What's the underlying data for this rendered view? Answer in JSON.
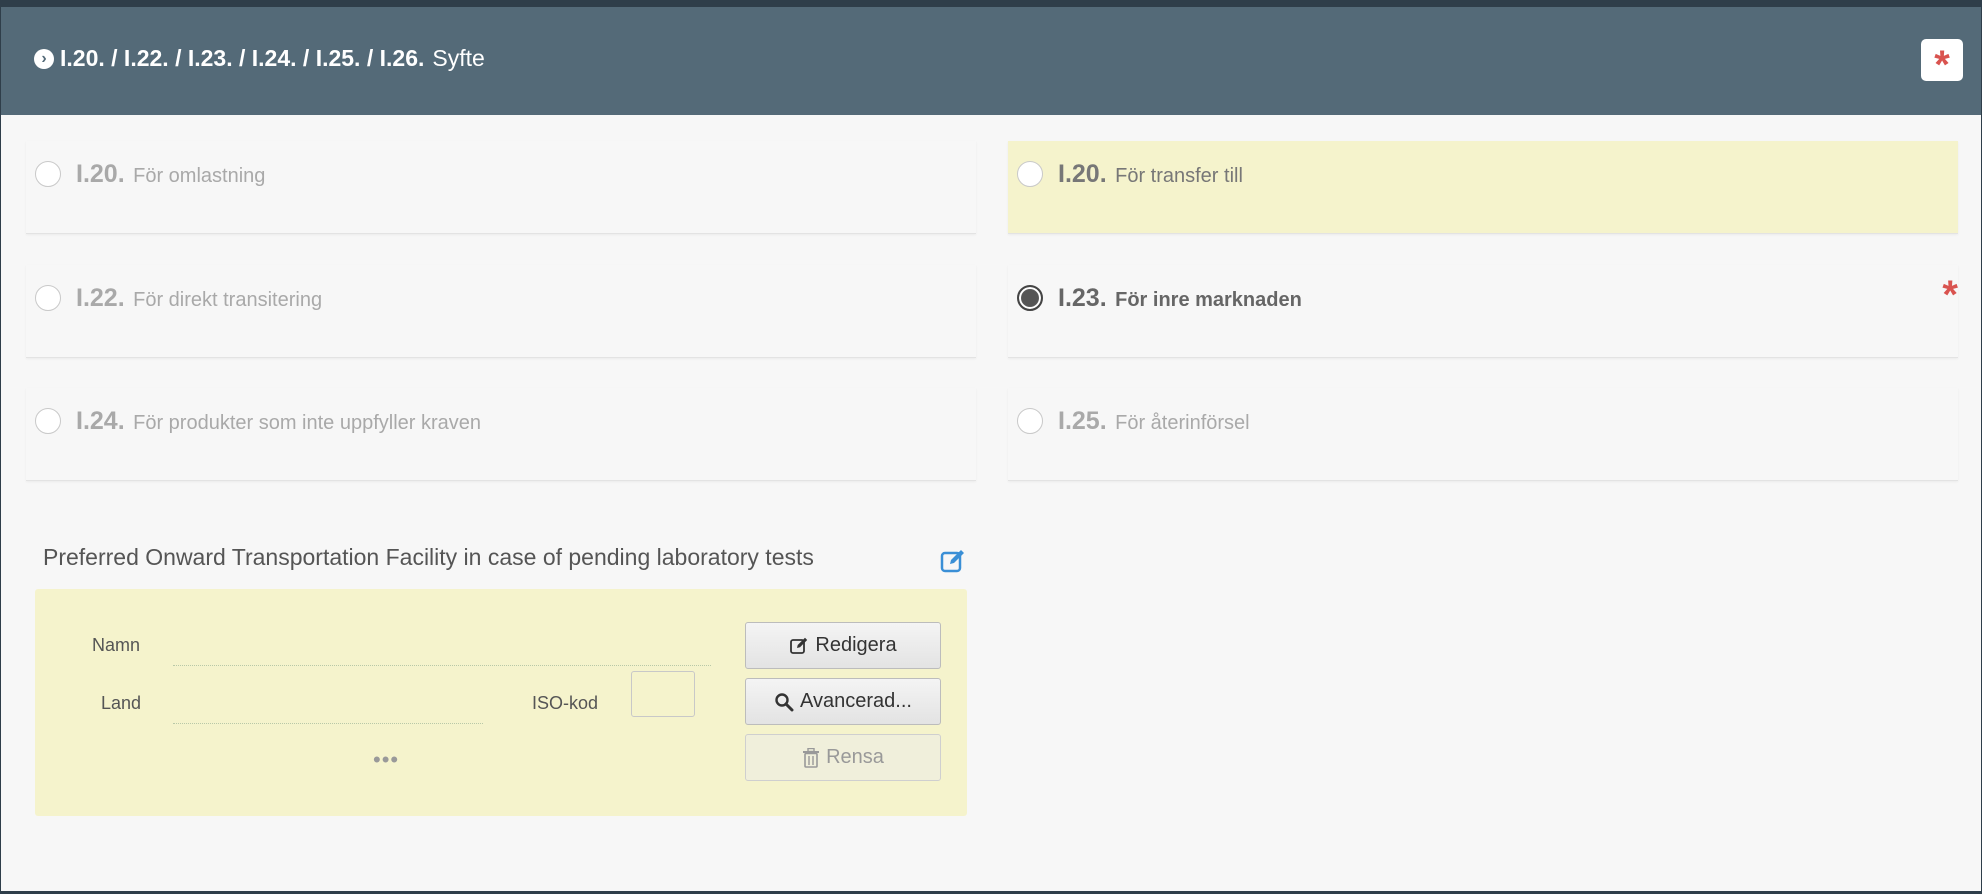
{
  "header": {
    "codes": "I.20. / I.22. / I.23. / I.24. / I.25. / I.26.",
    "title": "Syfte",
    "chevron_icon": "chevron-circle-right-icon",
    "required_marker": "*"
  },
  "options": [
    {
      "code": "I.20.",
      "label": "För omlastning",
      "checked": false,
      "highlight": false
    },
    {
      "code": "I.20.",
      "label": "För transfer till",
      "checked": false,
      "highlight": true
    },
    {
      "code": "I.22.",
      "label": "För direkt transitering",
      "checked": false,
      "highlight": false
    },
    {
      "code": "I.23.",
      "label": "För inre marknaden",
      "checked": true,
      "highlight": false,
      "required_marker": "*"
    },
    {
      "code": "I.24.",
      "label": "För produkter som inte uppfyller kraven",
      "checked": false,
      "highlight": false
    },
    {
      "code": "I.25.",
      "label": "För återinförsel",
      "checked": false,
      "highlight": false
    }
  ],
  "facility": {
    "title": "Preferred Onward Transportation Facility in case of pending laboratory tests",
    "edit_icon": "edit-icon",
    "name_label": "Namn",
    "name_value": "",
    "country_label": "Land",
    "country_value": "",
    "iso_label": "ISO-kod",
    "iso_value": "",
    "more": "•••",
    "buttons": {
      "edit": "Redigera",
      "advanced": "Avancerad...",
      "clear": "Rensa"
    }
  },
  "colors": {
    "header_bg": "#546a78",
    "highlight_bg": "#f5f3cc",
    "required": "#d9534f",
    "edit_icon": "#3a8fd6"
  }
}
